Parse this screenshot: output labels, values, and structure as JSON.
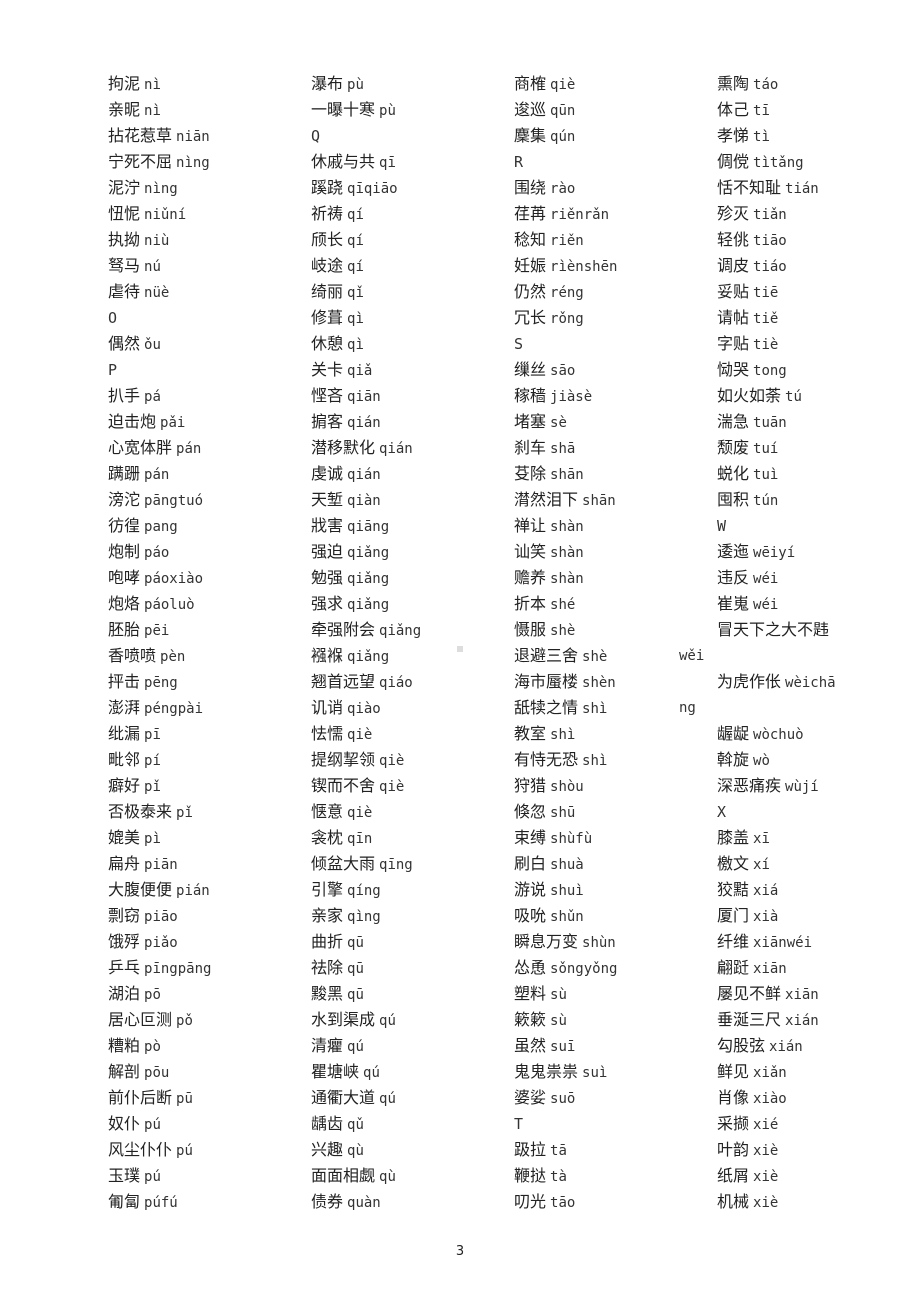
{
  "columns": [
    [
      {
        "word": "拘泥",
        "pinyin": "nì"
      },
      {
        "word": "亲昵",
        "pinyin": "nì"
      },
      {
        "word": "拈花惹草",
        "pinyin": "niān"
      },
      {
        "word": "宁死不屈",
        "pinyin": "nìng"
      },
      {
        "word": "泥泞",
        "pinyin": "nìng"
      },
      {
        "word": "忸怩",
        "pinyin": "niǔní"
      },
      {
        "word": "执拗",
        "pinyin": "niù"
      },
      {
        "word": "驽马",
        "pinyin": "nú"
      },
      {
        "word": "虐待",
        "pinyin": "nüè"
      },
      {
        "letter": "O"
      },
      {
        "word": "偶然",
        "pinyin": "ǒu"
      },
      {
        "letter": "P"
      },
      {
        "word": "扒手",
        "pinyin": "pá"
      },
      {
        "word": "迫击炮",
        "pinyin": "pǎi"
      },
      {
        "word": "心宽体胖",
        "pinyin": "pán"
      },
      {
        "word": "蹒跚",
        "pinyin": "pán"
      },
      {
        "word": "滂沱",
        "pinyin": "pāngtuó"
      },
      {
        "word": "彷徨",
        "pinyin": "pang"
      },
      {
        "word": "炮制",
        "pinyin": "páo"
      },
      {
        "word": "咆哮",
        "pinyin": "páoxiào"
      },
      {
        "word": "炮烙",
        "pinyin": "páoluò"
      },
      {
        "word": "胚胎",
        "pinyin": "pēi"
      },
      {
        "word": "香喷喷",
        "pinyin": "pèn"
      },
      {
        "word": "抨击",
        "pinyin": "pēng"
      },
      {
        "word": "澎湃",
        "pinyin": "péngpài"
      },
      {
        "word": "纰漏",
        "pinyin": "pī"
      },
      {
        "word": "毗邻",
        "pinyin": "pí"
      },
      {
        "word": "癖好",
        "pinyin": "pǐ"
      },
      {
        "word": "否极泰来",
        "pinyin": "pǐ"
      },
      {
        "word": "媲美",
        "pinyin": "pì"
      },
      {
        "word": "扁舟",
        "pinyin": "piān"
      },
      {
        "word": "大腹便便",
        "pinyin": "pián"
      },
      {
        "word": "剽窃",
        "pinyin": "piāo"
      },
      {
        "word": "饿殍",
        "pinyin": "piǎo"
      },
      {
        "word": "乒乓",
        "pinyin": "pīngpāng"
      },
      {
        "word": "湖泊",
        "pinyin": "pō"
      },
      {
        "word": "居心叵测",
        "pinyin": "pǒ"
      },
      {
        "word": "糟粕",
        "pinyin": "pò"
      },
      {
        "word": "解剖",
        "pinyin": "pōu"
      },
      {
        "word": "前仆后断",
        "pinyin": "pū"
      },
      {
        "word": "奴仆",
        "pinyin": "pú"
      },
      {
        "word": "风尘仆仆",
        "pinyin": "pú"
      },
      {
        "word": "玉璞",
        "pinyin": "pú"
      },
      {
        "word": "匍匐",
        "pinyin": "púfú"
      }
    ],
    [
      {
        "word": "瀑布",
        "pinyin": "pù"
      },
      {
        "word": "一曝十寒",
        "pinyin": "pù"
      },
      {
        "letter": "Q"
      },
      {
        "word": "休戚与共",
        "pinyin": "qī"
      },
      {
        "word": "蹊跷",
        "pinyin": "qīqiāo"
      },
      {
        "word": "祈祷",
        "pinyin": "qí"
      },
      {
        "word": "颀长",
        "pinyin": "qí"
      },
      {
        "word": "岐途",
        "pinyin": "qí"
      },
      {
        "word": "绮丽",
        "pinyin": "qǐ"
      },
      {
        "word": "修葺",
        "pinyin": "qì"
      },
      {
        "word": "休憩",
        "pinyin": "qì"
      },
      {
        "word": "关卡",
        "pinyin": "qiǎ"
      },
      {
        "word": "悭吝",
        "pinyin": "qiān"
      },
      {
        "word": "掮客",
        "pinyin": "qián"
      },
      {
        "word": "潜移默化",
        "pinyin": "qián"
      },
      {
        "word": "虔诚",
        "pinyin": "qián"
      },
      {
        "word": "天堑",
        "pinyin": "qiàn"
      },
      {
        "word": "戕害",
        "pinyin": "qiāng"
      },
      {
        "word": "强迫",
        "pinyin": "qiǎng"
      },
      {
        "word": "勉强",
        "pinyin": "qiǎng"
      },
      {
        "word": "强求",
        "pinyin": "qiǎng"
      },
      {
        "word": "牵强附会",
        "pinyin": "qiǎng"
      },
      {
        "word": "襁褓",
        "pinyin": "qiǎng"
      },
      {
        "word": "翘首远望",
        "pinyin": "qiáo"
      },
      {
        "word": "讥诮",
        "pinyin": "qiào"
      },
      {
        "word": "怯懦",
        "pinyin": "qiè"
      },
      {
        "word": "提纲挈领",
        "pinyin": "qiè"
      },
      {
        "word": "锲而不舍",
        "pinyin": "qiè"
      },
      {
        "word": "惬意",
        "pinyin": "qiè"
      },
      {
        "word": "衾枕",
        "pinyin": "qīn"
      },
      {
        "word": "倾盆大雨",
        "pinyin": "qīng"
      },
      {
        "word": "引擎",
        "pinyin": "qíng"
      },
      {
        "word": "亲家",
        "pinyin": "qìng"
      },
      {
        "word": "曲折",
        "pinyin": "qū"
      },
      {
        "word": "祛除",
        "pinyin": "qū"
      },
      {
        "word": "黢黑",
        "pinyin": "qū"
      },
      {
        "word": "水到渠成",
        "pinyin": "qú"
      },
      {
        "word": "清癯",
        "pinyin": "qú"
      },
      {
        "word": "瞿塘峡",
        "pinyin": "qú"
      },
      {
        "word": "通衢大道",
        "pinyin": "qú"
      },
      {
        "word": "龋齿",
        "pinyin": "qǔ"
      },
      {
        "word": "兴趣",
        "pinyin": "qù"
      },
      {
        "word": "面面相觑",
        "pinyin": "qù"
      },
      {
        "word": "债券",
        "pinyin": "quàn"
      }
    ],
    [
      {
        "word": "商榷",
        "pinyin": "qiè"
      },
      {
        "word": "逡巡",
        "pinyin": "qūn"
      },
      {
        "word": "麇集",
        "pinyin": "qún"
      },
      {
        "letter": "R"
      },
      {
        "word": "围绕",
        "pinyin": "rào"
      },
      {
        "word": "荏苒",
        "pinyin": "riěnrǎn"
      },
      {
        "word": "稔知",
        "pinyin": "riěn"
      },
      {
        "word": "妊娠",
        "pinyin": "rìènshēn"
      },
      {
        "word": "仍然",
        "pinyin": "réng"
      },
      {
        "word": "冗长",
        "pinyin": "rǒng"
      },
      {
        "letter": "S"
      },
      {
        "word": "缫丝",
        "pinyin": "sāo"
      },
      {
        "word": "稼穑",
        "pinyin": "jiàsè"
      },
      {
        "word": "堵塞",
        "pinyin": "sè"
      },
      {
        "word": "刹车",
        "pinyin": "shā"
      },
      {
        "word": "芟除",
        "pinyin": "shān"
      },
      {
        "word": "潸然泪下",
        "pinyin": "shān"
      },
      {
        "word": "禅让",
        "pinyin": "shàn"
      },
      {
        "word": "讪笑",
        "pinyin": "shàn"
      },
      {
        "word": "赡养",
        "pinyin": "shàn"
      },
      {
        "word": "折本",
        "pinyin": "shé"
      },
      {
        "word": "慑服",
        "pinyin": "shè"
      },
      {
        "word": "退避三舍",
        "pinyin": "shè"
      },
      {
        "word": "海市蜃楼",
        "pinyin": "shèn"
      },
      {
        "word": "舐犊之情",
        "pinyin": "shì"
      },
      {
        "word": "教室",
        "pinyin": "shì"
      },
      {
        "word": "有恃无恐",
        "pinyin": "shì"
      },
      {
        "word": "狩猎",
        "pinyin": "shòu"
      },
      {
        "word": "倏忽",
        "pinyin": "shū"
      },
      {
        "word": "束缚",
        "pinyin": "shùfù"
      },
      {
        "word": "刷白",
        "pinyin": "shuà"
      },
      {
        "word": "游说",
        "pinyin": "shuì"
      },
      {
        "word": "吸吮",
        "pinyin": "shǔn"
      },
      {
        "word": "瞬息万变",
        "pinyin": "shùn"
      },
      {
        "word": "怂恿",
        "pinyin": "sǒngyǒng"
      },
      {
        "word": "塑料",
        "pinyin": "sù"
      },
      {
        "word": "簌簌",
        "pinyin": "sù"
      },
      {
        "word": "虽然",
        "pinyin": "suī"
      },
      {
        "word": "鬼鬼祟祟",
        "pinyin": "suì"
      },
      {
        "word": "婆娑",
        "pinyin": "suō"
      },
      {
        "letter": "T"
      },
      {
        "word": "趿拉",
        "pinyin": "tā"
      },
      {
        "word": "鞭挞",
        "pinyin": "tà"
      },
      {
        "word": "叨光",
        "pinyin": "tāo"
      }
    ],
    [
      {
        "word": "熏陶",
        "pinyin": "táo"
      },
      {
        "word": "体己",
        "pinyin": "tī"
      },
      {
        "word": "孝悌",
        "pinyin": "tì"
      },
      {
        "word": "倜傥",
        "pinyin": "tìtǎng"
      },
      {
        "word": "恬不知耻",
        "pinyin": "tián"
      },
      {
        "word": "殄灭",
        "pinyin": "tiǎn"
      },
      {
        "word": "轻佻",
        "pinyin": "tiāo"
      },
      {
        "word": "调皮",
        "pinyin": "tiáo"
      },
      {
        "word": "妥贴",
        "pinyin": "tiē"
      },
      {
        "word": "请帖",
        "pinyin": "tiě"
      },
      {
        "word": "字贴",
        "pinyin": "tiè"
      },
      {
        "word": "恸哭",
        "pinyin": "tong"
      },
      {
        "word": "如火如荼",
        "pinyin": "tú"
      },
      {
        "word": "湍急",
        "pinyin": "tuān"
      },
      {
        "word": "颓废",
        "pinyin": "tuí"
      },
      {
        "word": "蜕化",
        "pinyin": "tuì"
      },
      {
        "word": "囤积",
        "pinyin": "tún"
      },
      {
        "letter": "W"
      },
      {
        "word": "逶迤",
        "pinyin": "wēiyí"
      },
      {
        "word": "违反",
        "pinyin": "wéi"
      },
      {
        "word": "崔嵬",
        "pinyin": "wéi"
      },
      {
        "word": "冒天下之大不韪",
        "pinyin": ""
      },
      {
        "spacer": true
      },
      {
        "word": "为虎作伥",
        "pinyin": "wèichā"
      },
      {
        "spacer": true
      },
      {
        "word": "龌龊",
        "pinyin": "wòchuò"
      },
      {
        "word": "斡旋",
        "pinyin": "wò"
      },
      {
        "word": "深恶痛疾",
        "pinyin": "wùjí"
      },
      {
        "letter": "X"
      },
      {
        "word": "膝盖",
        "pinyin": "xī"
      },
      {
        "word": "檄文",
        "pinyin": "xí"
      },
      {
        "word": "狡黠",
        "pinyin": "xiá"
      },
      {
        "word": "厦门",
        "pinyin": "xià"
      },
      {
        "word": "纤维",
        "pinyin": "xiānwéi"
      },
      {
        "word": "翩跹",
        "pinyin": "xiān"
      },
      {
        "word": "屡见不鲜",
        "pinyin": "xiān"
      },
      {
        "word": "垂涎三尺",
        "pinyin": "xián"
      },
      {
        "word": "勾股弦",
        "pinyin": "xián"
      },
      {
        "word": "鲜见",
        "pinyin": "xiǎn"
      },
      {
        "word": "肖像",
        "pinyin": "xiào"
      },
      {
        "word": "采撷",
        "pinyin": "xié"
      },
      {
        "word": "叶韵",
        "pinyin": "xiè"
      },
      {
        "word": "纸屑",
        "pinyin": "xiè"
      },
      {
        "word": "机械",
        "pinyin": "xiè"
      }
    ]
  ],
  "overflow": {
    "line1": "wěi",
    "line2": "ng"
  },
  "page_number": "3"
}
